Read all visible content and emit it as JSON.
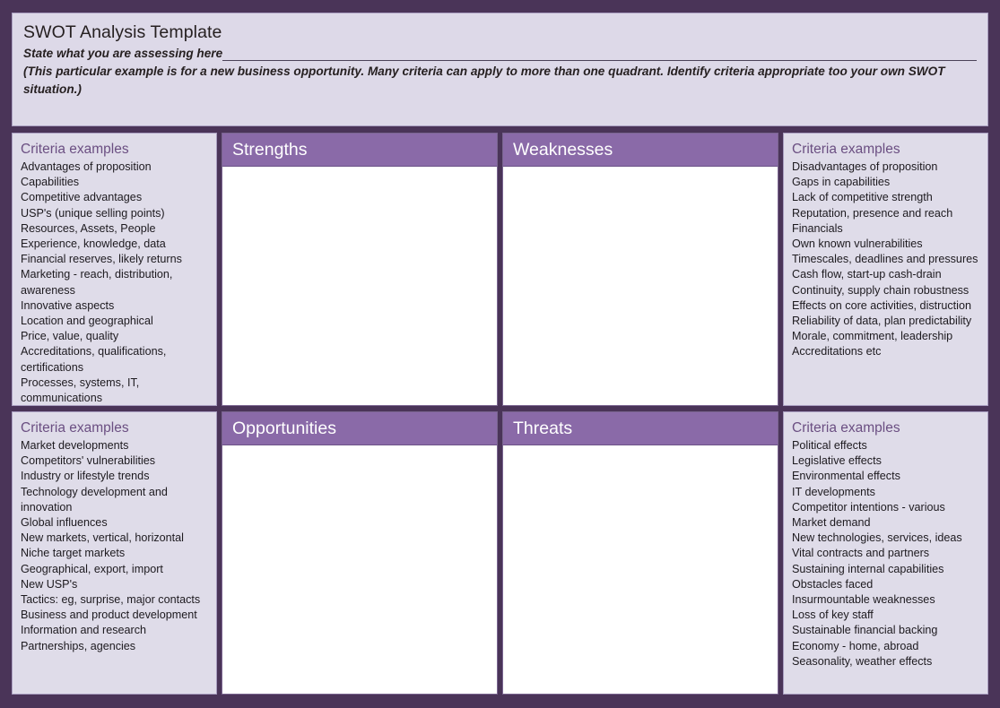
{
  "header": {
    "title": "SWOT Analysis Template",
    "subject_label": "State what you are assessing here",
    "note": "(This particular example is for a new business opportunity. Many criteria can apply to more than one quadrant. Identify criteria appropriate too your own SWOT situation.)"
  },
  "colors": {
    "page_background": "#4a3458",
    "panel_background": "#dfdce9",
    "header_panel_background": "#ddd9e8",
    "quadrant_header": "#8a6aa8",
    "quadrant_body": "#ffffff",
    "criteria_heading": "#6b4f82",
    "body_text": "#1d1a1f"
  },
  "criteria_heading": "Criteria examples",
  "quadrants": {
    "strengths": {
      "title": "Strengths",
      "content": ""
    },
    "weaknesses": {
      "title": "Weaknesses",
      "content": ""
    },
    "opportunities": {
      "title": "Opportunities",
      "content": ""
    },
    "threats": {
      "title": "Threats",
      "content": ""
    }
  },
  "criteria": {
    "strengths": {
      "title": "Criteria examples",
      "items": [
        "Advantages of proposition",
        "Capabilities",
        "Competitive advantages",
        "USP's (unique selling points)",
        "Resources, Assets, People",
        "Experience, knowledge, data",
        "Financial reserves, likely returns",
        "Marketing -  reach, distribution, awareness",
        "Innovative aspects",
        "Location and geographical",
        "Price, value, quality",
        "Accreditations, qualifications, certifications",
        "Processes, systems, IT, communications"
      ]
    },
    "weaknesses": {
      "title": "Criteria examples",
      "items": [
        "Disadvantages of proposition",
        "Gaps in capabilities",
        "Lack of competitive strength",
        "Reputation, presence and reach",
        "Financials",
        "Own known vulnerabilities",
        "Timescales, deadlines and pressures",
        "Cash flow, start-up cash-drain",
        "Continuity, supply chain robustness",
        "Effects on core activities, distruction",
        "Reliability of data, plan predictability",
        "Morale, commitment, leadership",
        "Accreditations etc"
      ]
    },
    "opportunities": {
      "title": "Criteria examples",
      "items": [
        "Market developments",
        "Competitors' vulnerabilities",
        "Industry or lifestyle trends",
        "Technology development and innovation",
        "Global influences",
        "New markets, vertical, horizontal",
        "Niche target markets",
        "Geographical, export, import",
        "New USP's",
        "Tactics: eg, surprise, major contacts",
        "Business and product development",
        "Information and research",
        "Partnerships, agencies"
      ]
    },
    "threats": {
      "title": "Criteria examples",
      "items": [
        "Political effects",
        "Legislative effects",
        "Environmental effects",
        "IT developments",
        "Competitor intentions - various",
        "Market demand",
        "New technologies, services, ideas",
        "Vital contracts and partners",
        "Sustaining internal capabilities",
        "Obstacles faced",
        "Insurmountable weaknesses",
        "Loss of key staff",
        "Sustainable financial backing",
        "Economy - home, abroad",
        "Seasonality, weather effects"
      ]
    }
  }
}
